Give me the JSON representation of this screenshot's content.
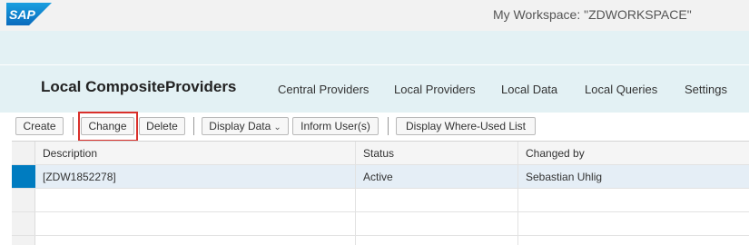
{
  "header": {
    "logo_text": "SAP",
    "workspace_title": "My Workspace: \"ZDWORKSPACE\""
  },
  "nav": {
    "page_title": "Local CompositeProviders",
    "links": [
      "Central Providers",
      "Local Providers",
      "Local Data",
      "Local Queries",
      "Settings"
    ]
  },
  "toolbar": {
    "create": "Create",
    "change": "Change",
    "delete": "Delete",
    "display_data": "Display Data",
    "inform_users": "Inform User(s)",
    "where_used": "Display Where-Used List"
  },
  "table": {
    "columns": [
      "Description",
      "Status",
      "Changed by"
    ],
    "rows": [
      {
        "description": "[ZDW1852278]",
        "status": "Active",
        "changed_by": "Sebastian Uhlig",
        "selected": true
      }
    ]
  },
  "colors": {
    "brand_blue": "#0a76c2",
    "selection_marker": "#007cc0",
    "highlight_frame": "#d9302b",
    "band_background": "#e3f1f4"
  }
}
